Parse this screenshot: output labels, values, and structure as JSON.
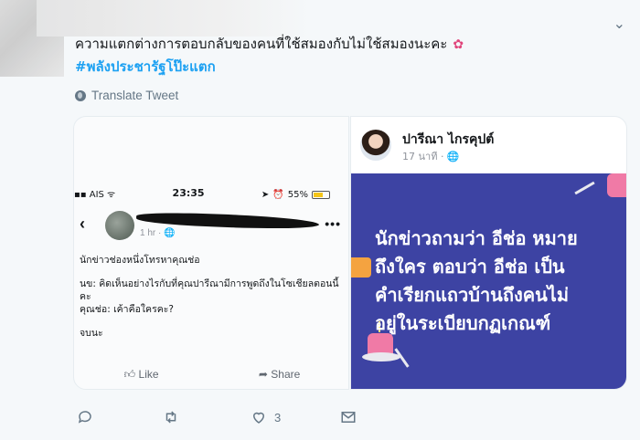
{
  "tweet": {
    "caret": "⌄",
    "text_line1": "ความแตกต่างการตอบกลับของคนที่ใช้สมองกับไม่ใช้สมองนะคะ",
    "hashtag": "#พลังประชารัฐโป๊ะแตก",
    "translate_label": "Translate Tweet",
    "like_count": "3"
  },
  "media_left": {
    "status": {
      "carrier": "AIS",
      "time": "23:35",
      "battery": "55%"
    },
    "post_meta": "1 hr · 🌐",
    "body": [
      "นักข่าวช่องหนึ่งโทรหาคุณช่อ",
      "นข: คิดเห็นอย่างไรกับที่คุณปารีณามีการพูดถึงในโซเชียลตอนนี้คะ",
      "คุณช่อ: เค้าคือใครคะ?",
      "จบนะ"
    ],
    "like_label": "Like",
    "share_label": "Share"
  },
  "media_right": {
    "name": "ปารีณา ไกรคุปต์",
    "meta": "17 นาที · 🌐",
    "banner_lines": [
      "นักข่าวถามว่า อีช่อ หมาย",
      "ถึงใคร ตอบว่า อีช่อ เป็น",
      "คำเรียกแถวบ้านถึงคนไม่",
      "อยู่ในระเบียบกฏเกณฑ์"
    ]
  },
  "colors": {
    "accent": "#1da1f2",
    "banner": "#3d43a3",
    "muted": "#657786"
  },
  "icons": [
    "globe-icon",
    "reply-icon",
    "retweet-icon",
    "like-icon",
    "message-icon",
    "caret-down-icon"
  ]
}
